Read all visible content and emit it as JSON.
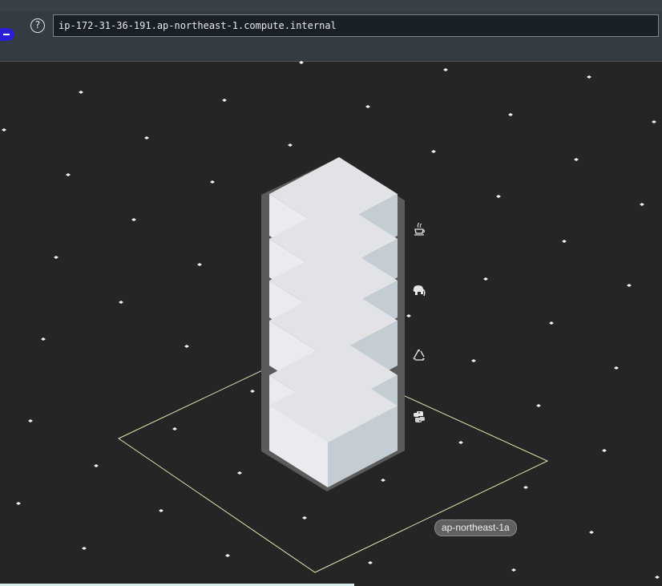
{
  "toolbar": {
    "help_symbol": "?",
    "search_value": "ip-172-31-36-191.ap-northeast-1.compute.internal"
  },
  "scene": {
    "zone_label": "ap-northeast-1a",
    "block_count": 6,
    "icons": [
      "coffee-icon",
      "elephant-icon",
      "recycle-icon",
      "python-icon"
    ],
    "colors": {
      "background": "#252525",
      "zone_outline": "#d9e8b0",
      "block_top": "#e1e3e6",
      "block_left": "#e9ebee",
      "block_right": "#c4cdd3",
      "rack_frame": "#5b5b5b"
    }
  }
}
